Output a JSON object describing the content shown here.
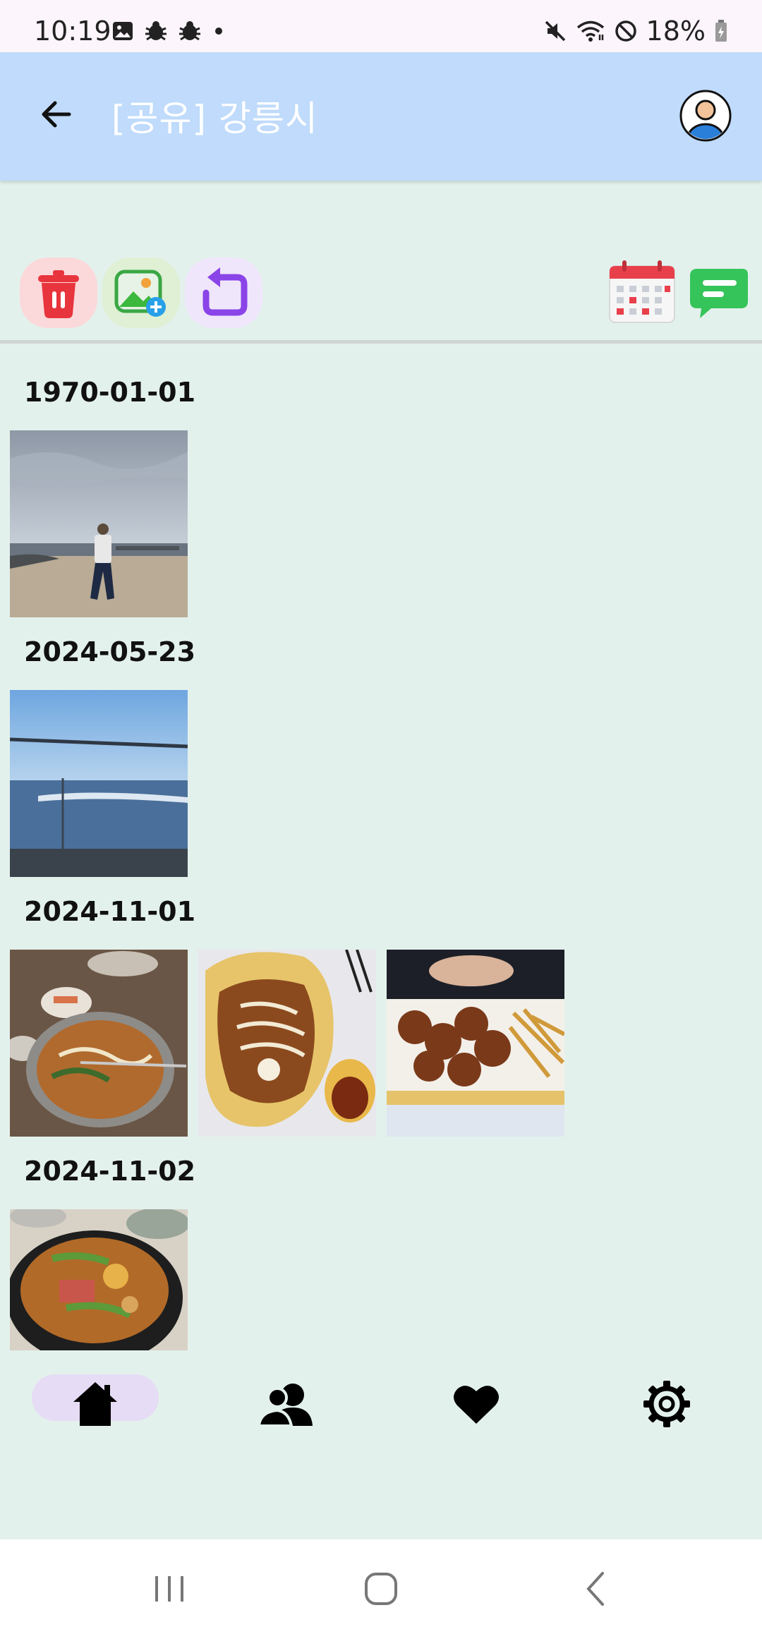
{
  "status_bar": {
    "time": "10:19",
    "battery": "18%",
    "icons": [
      "image-icon",
      "bug-icon",
      "bug-icon",
      "dot-icon",
      "mute-icon",
      "wifi-icon",
      "dnd-icon",
      "battery-icon"
    ]
  },
  "app_bar": {
    "title": "[공유] 강릉시",
    "back_icon": "arrow-left-icon",
    "profile_icon": "avatar-icon"
  },
  "toolbar": {
    "left_actions": [
      "trash-icon",
      "add-photo-icon",
      "refresh-icon"
    ],
    "right_actions": [
      "calendar-icon",
      "chat-icon"
    ],
    "colors": {
      "trash": "#e8343d",
      "add_photo": "#3cb83c",
      "refresh": "#8a44e8",
      "calendar": "#e8404b",
      "chat": "#35c45a"
    }
  },
  "gallery": {
    "groups": [
      {
        "date": "1970-01-01",
        "photos": [
          "beach-person-photo"
        ]
      },
      {
        "date": "2024-05-23",
        "photos": [
          "sea-view-photo"
        ]
      },
      {
        "date": "2024-11-01",
        "photos": [
          "noodle-soup-photo",
          "ramen-bowl-photo",
          "fried-chicken-photo"
        ]
      },
      {
        "date": "2024-11-02",
        "photos": [
          "stew-pot-photo"
        ]
      }
    ]
  },
  "bottom_nav": {
    "items": [
      "home-icon",
      "people-icon",
      "heart-icon",
      "settings-icon"
    ],
    "selected": 0
  },
  "system_nav": {
    "items": [
      "recents-icon",
      "home-circle-icon",
      "back-chevron-icon"
    ]
  }
}
